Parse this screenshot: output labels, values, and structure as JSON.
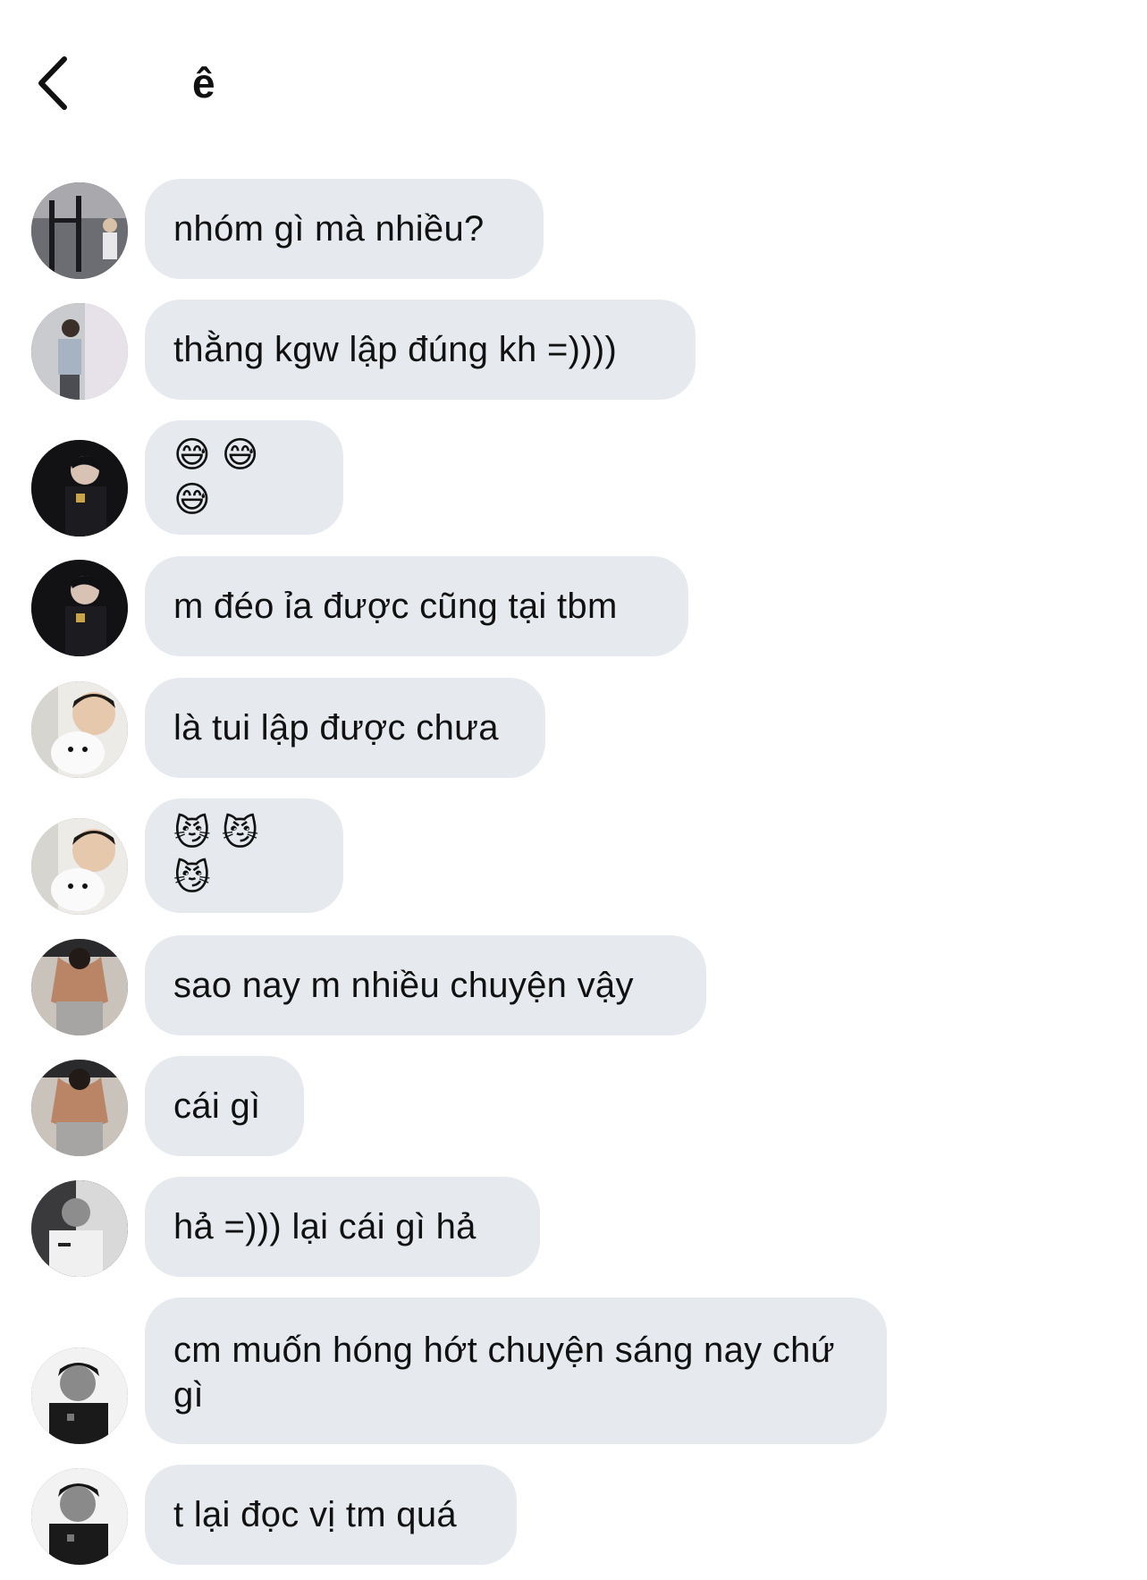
{
  "header": {
    "title": "ê",
    "back_icon": "chevron-left-icon"
  },
  "messages": [
    {
      "text": "nhóm gì mà nhiều?",
      "avatar": "avatar-gym"
    },
    {
      "text": "thằng kgw lập đúng kh =))))",
      "avatar": "avatar-door"
    },
    {
      "text": "😅😅😅",
      "avatar": "avatar-dark-a"
    },
    {
      "text": "m đéo ỉa được cũng tại tbm",
      "avatar": "avatar-dark-a"
    },
    {
      "text": "là tui lập được chưa",
      "avatar": "avatar-dog"
    },
    {
      "text": "😼😼😼",
      "avatar": "avatar-dog"
    },
    {
      "text": "sao nay m nhiều chuyện vậy",
      "avatar": "avatar-back"
    },
    {
      "text": "cái gì",
      "avatar": "avatar-back"
    },
    {
      "text": "hả =))) lại cái gì hả",
      "avatar": "avatar-bw"
    },
    {
      "text": "cm muốn hóng hớt chuyện sáng nay chứ gì",
      "avatar": "avatar-dark-b"
    },
    {
      "text": "t lại đọc vị tm quá",
      "avatar": "avatar-dark-b"
    }
  ],
  "colors": {
    "bubble": "#e6eaef",
    "background": "#ffffff",
    "text": "#111111"
  }
}
